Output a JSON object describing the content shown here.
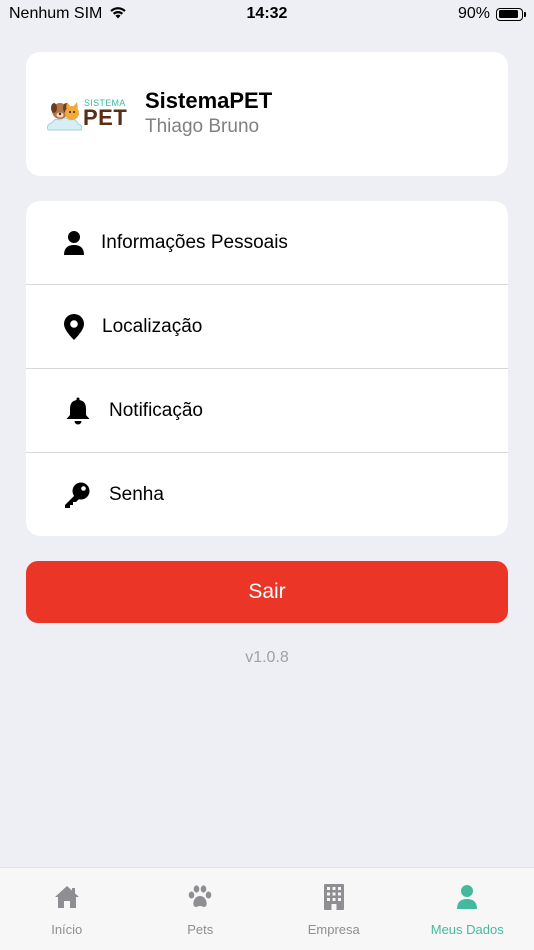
{
  "status_bar": {
    "carrier": "Nenhum SIM",
    "time": "14:32",
    "battery": "90%",
    "battery_level": 0.9
  },
  "profile": {
    "logo_small": "SISTEMA",
    "logo_big": "PET",
    "app_name": "SistemaPET",
    "user_name": "Thiago Bruno"
  },
  "menu": {
    "items": [
      {
        "label": "Informações Pessoais",
        "icon": "user-icon"
      },
      {
        "label": "Localização",
        "icon": "location-pin-icon"
      },
      {
        "label": "Notificação",
        "icon": "bell-icon"
      },
      {
        "label": "Senha",
        "icon": "key-icon"
      }
    ]
  },
  "logout_label": "Sair",
  "version": "v1.0.8",
  "tabs": [
    {
      "label": "Início",
      "icon": "home-icon",
      "active": false
    },
    {
      "label": "Pets",
      "icon": "paw-icon",
      "active": false
    },
    {
      "label": "Empresa",
      "icon": "building-icon",
      "active": false
    },
    {
      "label": "Meus Dados",
      "icon": "user-icon",
      "active": true
    }
  ],
  "colors": {
    "accent": "#45b99e",
    "danger": "#eb3526",
    "background": "#eeeef5",
    "inactive": "#8e8e93"
  }
}
